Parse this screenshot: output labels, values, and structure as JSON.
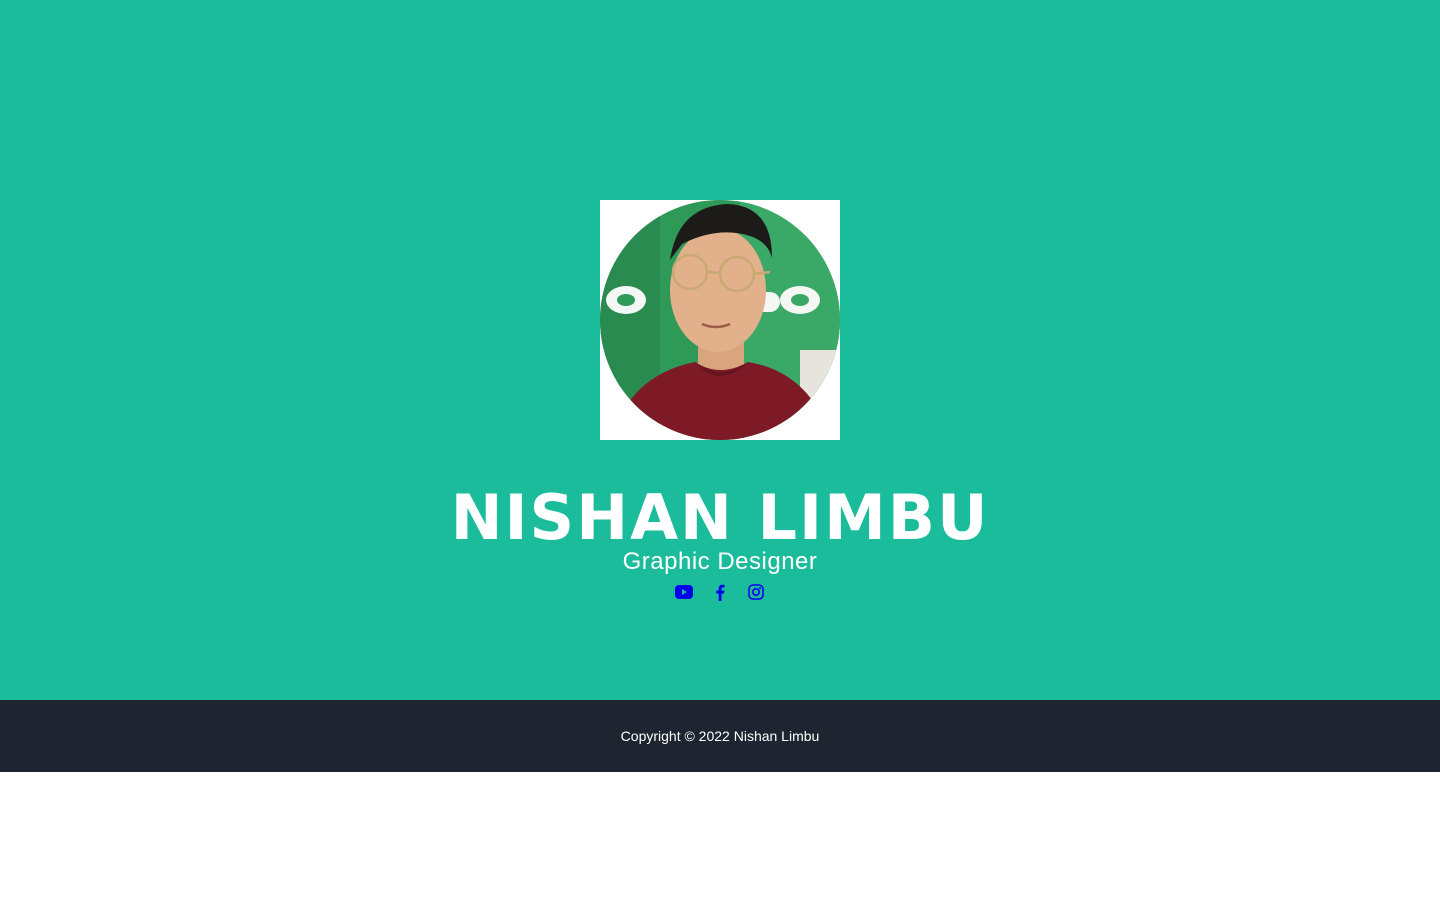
{
  "profile": {
    "name": "NISHAN LIMBU",
    "role": "Graphic Designer"
  },
  "social": [
    {
      "icon": "youtube-icon",
      "label": "YouTube"
    },
    {
      "icon": "facebook-icon",
      "label": "Facebook"
    },
    {
      "icon": "instagram-icon",
      "label": "Instagram"
    }
  ],
  "footer": {
    "copyright": "Copyright © 2022 Nishan Limbu"
  },
  "colors": {
    "hero_bg": "#1bbc9b",
    "footer_bg": "#1e2530",
    "icon_color": "#0000ee",
    "text": "#ffffff"
  }
}
